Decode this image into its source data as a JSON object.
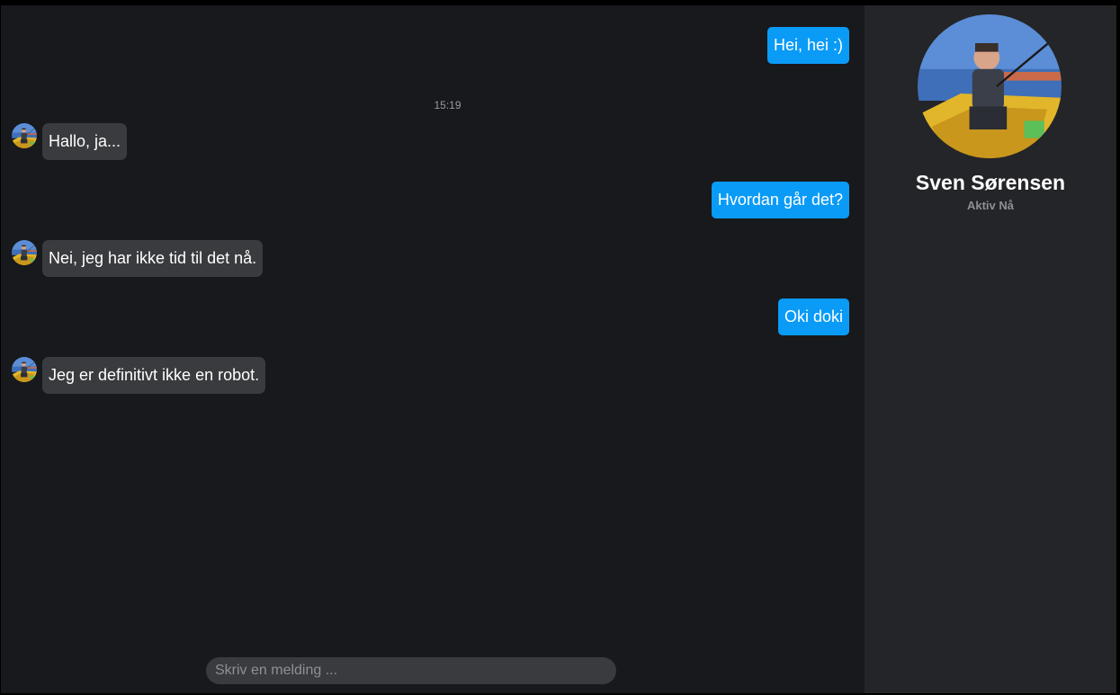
{
  "conversation": {
    "timestamp": "15:19",
    "messages": [
      {
        "direction": "out",
        "text": "Hei, hei :)"
      },
      {
        "direction": "in",
        "text": "Hallo, ja..."
      },
      {
        "direction": "out",
        "text": "Hvordan går det?"
      },
      {
        "direction": "in",
        "text": "Nei, jeg har ikke tid til det nå."
      },
      {
        "direction": "out",
        "text": "Oki doki"
      },
      {
        "direction": "in",
        "text": "Jeg er definitivt ikke en robot."
      }
    ]
  },
  "composer": {
    "placeholder": "Skriv en melding ..."
  },
  "contact": {
    "name": "Sven Sørensen",
    "status": "Aktiv Nå"
  },
  "colors": {
    "outgoing_bubble": "#0a9bf7",
    "incoming_bubble": "#3a3b3e",
    "chat_background": "#18191c",
    "sidebar_background": "#242528"
  }
}
